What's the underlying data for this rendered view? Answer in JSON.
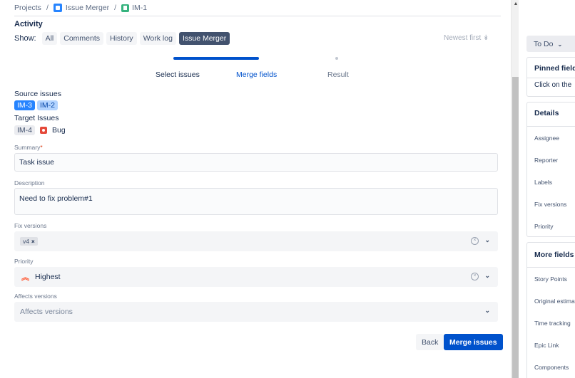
{
  "breadcrumb": {
    "projects": "Projects",
    "separator": "/",
    "project": "Issue Merger",
    "issue_key": "IM-1"
  },
  "activity": {
    "title": "Activity",
    "show_label": "Show:",
    "filters": [
      "All",
      "Comments",
      "History",
      "Work log",
      "Issue Merger"
    ],
    "active_filter": "Issue Merger",
    "sort_label": "Newest first ↡"
  },
  "stepper": {
    "steps": [
      "Select issues",
      "Merge fields",
      "Result"
    ],
    "current_step": 2,
    "completed_fraction": 0.5
  },
  "source": {
    "label": "Source issues",
    "issues": [
      "IM-3",
      "IM-2"
    ]
  },
  "target": {
    "label": "Target Issues",
    "issue": "IM-4",
    "type": "Bug",
    "type_icon": "bug-icon"
  },
  "fields": {
    "summary": {
      "label": "Summary",
      "required_mark": "*",
      "value": "Task issue"
    },
    "description": {
      "label": "Description",
      "value": "Need to fix problem#1"
    },
    "fix_versions": {
      "label": "Fix versions",
      "tags": [
        "v4"
      ],
      "remove_glyph": "×"
    },
    "priority": {
      "label": "Priority",
      "value": "Highest",
      "icon": "priority-highest-icon"
    },
    "affects_versions": {
      "label": "Affects versions",
      "placeholder": "Affects versions"
    }
  },
  "actions": {
    "back": "Back",
    "merge": "Merge issues"
  },
  "right_panel": {
    "status": "To Do",
    "pinned": {
      "title": "Pinned fields",
      "hint": "Click on the"
    },
    "details": {
      "title": "Details",
      "rows": [
        "Assignee",
        "Reporter",
        "Labels",
        "Fix versions",
        "Priority"
      ]
    },
    "more_fields": {
      "title": "More fields",
      "rows": [
        "Story Points",
        "Original estimate",
        "Time tracking",
        "Epic Link",
        "Components"
      ]
    }
  },
  "colors": {
    "accent": "#0052cc",
    "selected_chip": "#2684ff",
    "bug": "#e5493a",
    "priority_highest": "#ff5630"
  }
}
